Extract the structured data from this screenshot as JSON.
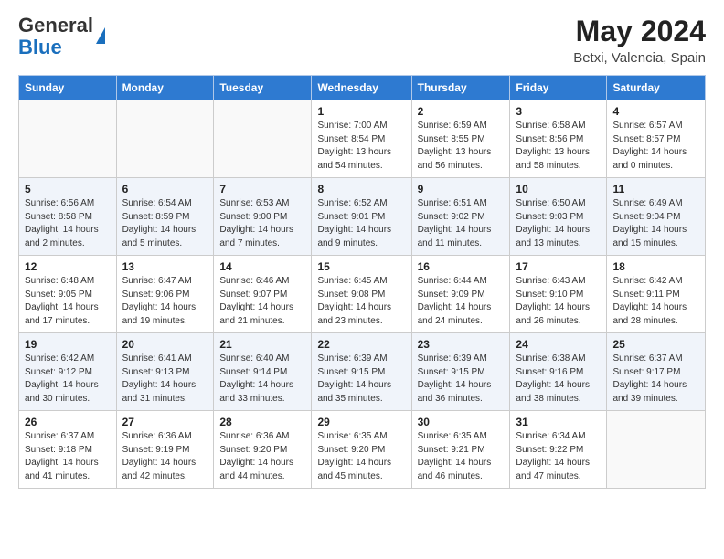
{
  "logo": {
    "general": "General",
    "blue": "Blue"
  },
  "title": "May 2024",
  "subtitle": "Betxi, Valencia, Spain",
  "headers": [
    "Sunday",
    "Monday",
    "Tuesday",
    "Wednesday",
    "Thursday",
    "Friday",
    "Saturday"
  ],
  "weeks": [
    [
      {
        "day": "",
        "info": ""
      },
      {
        "day": "",
        "info": ""
      },
      {
        "day": "",
        "info": ""
      },
      {
        "day": "1",
        "info": "Sunrise: 7:00 AM\nSunset: 8:54 PM\nDaylight: 13 hours\nand 54 minutes."
      },
      {
        "day": "2",
        "info": "Sunrise: 6:59 AM\nSunset: 8:55 PM\nDaylight: 13 hours\nand 56 minutes."
      },
      {
        "day": "3",
        "info": "Sunrise: 6:58 AM\nSunset: 8:56 PM\nDaylight: 13 hours\nand 58 minutes."
      },
      {
        "day": "4",
        "info": "Sunrise: 6:57 AM\nSunset: 8:57 PM\nDaylight: 14 hours\nand 0 minutes."
      }
    ],
    [
      {
        "day": "5",
        "info": "Sunrise: 6:56 AM\nSunset: 8:58 PM\nDaylight: 14 hours\nand 2 minutes."
      },
      {
        "day": "6",
        "info": "Sunrise: 6:54 AM\nSunset: 8:59 PM\nDaylight: 14 hours\nand 5 minutes."
      },
      {
        "day": "7",
        "info": "Sunrise: 6:53 AM\nSunset: 9:00 PM\nDaylight: 14 hours\nand 7 minutes."
      },
      {
        "day": "8",
        "info": "Sunrise: 6:52 AM\nSunset: 9:01 PM\nDaylight: 14 hours\nand 9 minutes."
      },
      {
        "day": "9",
        "info": "Sunrise: 6:51 AM\nSunset: 9:02 PM\nDaylight: 14 hours\nand 11 minutes."
      },
      {
        "day": "10",
        "info": "Sunrise: 6:50 AM\nSunset: 9:03 PM\nDaylight: 14 hours\nand 13 minutes."
      },
      {
        "day": "11",
        "info": "Sunrise: 6:49 AM\nSunset: 9:04 PM\nDaylight: 14 hours\nand 15 minutes."
      }
    ],
    [
      {
        "day": "12",
        "info": "Sunrise: 6:48 AM\nSunset: 9:05 PM\nDaylight: 14 hours\nand 17 minutes."
      },
      {
        "day": "13",
        "info": "Sunrise: 6:47 AM\nSunset: 9:06 PM\nDaylight: 14 hours\nand 19 minutes."
      },
      {
        "day": "14",
        "info": "Sunrise: 6:46 AM\nSunset: 9:07 PM\nDaylight: 14 hours\nand 21 minutes."
      },
      {
        "day": "15",
        "info": "Sunrise: 6:45 AM\nSunset: 9:08 PM\nDaylight: 14 hours\nand 23 minutes."
      },
      {
        "day": "16",
        "info": "Sunrise: 6:44 AM\nSunset: 9:09 PM\nDaylight: 14 hours\nand 24 minutes."
      },
      {
        "day": "17",
        "info": "Sunrise: 6:43 AM\nSunset: 9:10 PM\nDaylight: 14 hours\nand 26 minutes."
      },
      {
        "day": "18",
        "info": "Sunrise: 6:42 AM\nSunset: 9:11 PM\nDaylight: 14 hours\nand 28 minutes."
      }
    ],
    [
      {
        "day": "19",
        "info": "Sunrise: 6:42 AM\nSunset: 9:12 PM\nDaylight: 14 hours\nand 30 minutes."
      },
      {
        "day": "20",
        "info": "Sunrise: 6:41 AM\nSunset: 9:13 PM\nDaylight: 14 hours\nand 31 minutes."
      },
      {
        "day": "21",
        "info": "Sunrise: 6:40 AM\nSunset: 9:14 PM\nDaylight: 14 hours\nand 33 minutes."
      },
      {
        "day": "22",
        "info": "Sunrise: 6:39 AM\nSunset: 9:15 PM\nDaylight: 14 hours\nand 35 minutes."
      },
      {
        "day": "23",
        "info": "Sunrise: 6:39 AM\nSunset: 9:15 PM\nDaylight: 14 hours\nand 36 minutes."
      },
      {
        "day": "24",
        "info": "Sunrise: 6:38 AM\nSunset: 9:16 PM\nDaylight: 14 hours\nand 38 minutes."
      },
      {
        "day": "25",
        "info": "Sunrise: 6:37 AM\nSunset: 9:17 PM\nDaylight: 14 hours\nand 39 minutes."
      }
    ],
    [
      {
        "day": "26",
        "info": "Sunrise: 6:37 AM\nSunset: 9:18 PM\nDaylight: 14 hours\nand 41 minutes."
      },
      {
        "day": "27",
        "info": "Sunrise: 6:36 AM\nSunset: 9:19 PM\nDaylight: 14 hours\nand 42 minutes."
      },
      {
        "day": "28",
        "info": "Sunrise: 6:36 AM\nSunset: 9:20 PM\nDaylight: 14 hours\nand 44 minutes."
      },
      {
        "day": "29",
        "info": "Sunrise: 6:35 AM\nSunset: 9:20 PM\nDaylight: 14 hours\nand 45 minutes."
      },
      {
        "day": "30",
        "info": "Sunrise: 6:35 AM\nSunset: 9:21 PM\nDaylight: 14 hours\nand 46 minutes."
      },
      {
        "day": "31",
        "info": "Sunrise: 6:34 AM\nSunset: 9:22 PM\nDaylight: 14 hours\nand 47 minutes."
      },
      {
        "day": "",
        "info": ""
      }
    ]
  ]
}
